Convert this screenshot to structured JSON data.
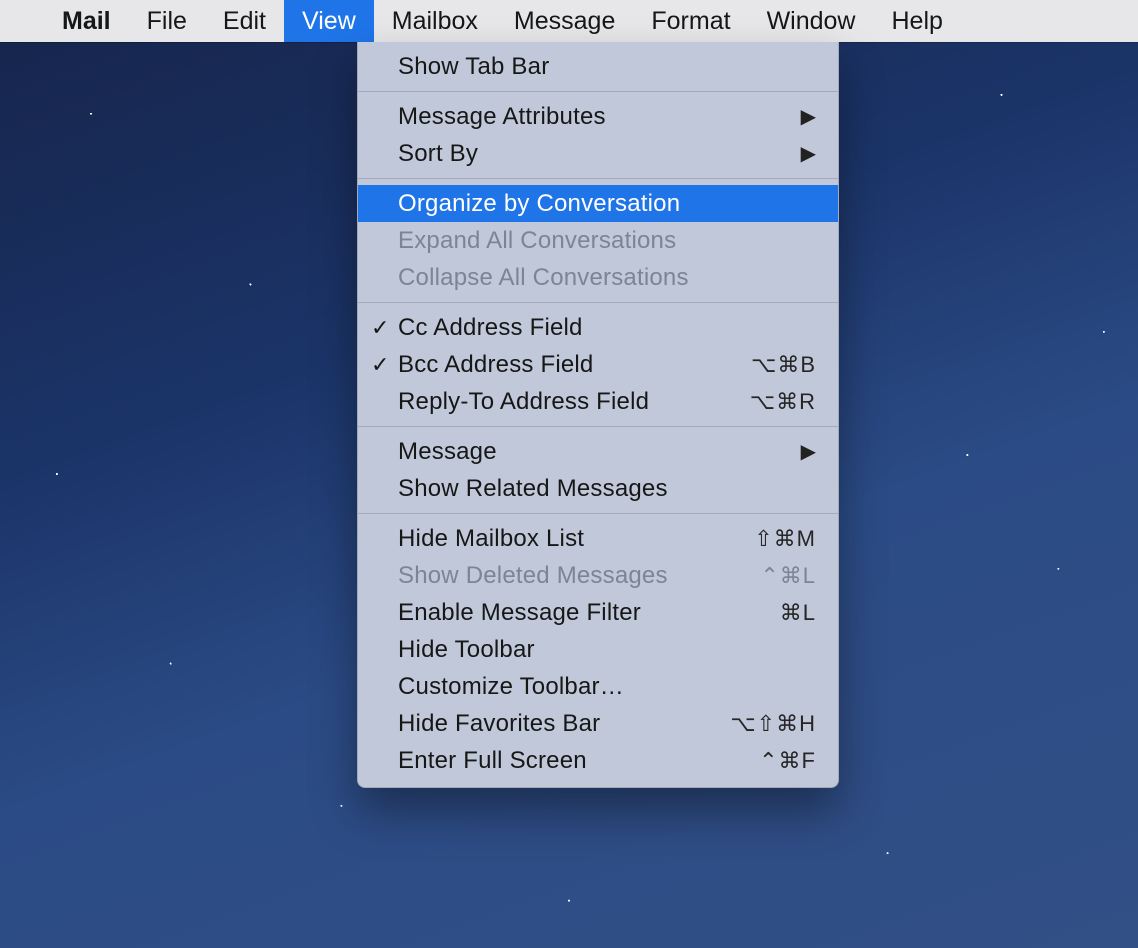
{
  "menubar": {
    "apple_icon": "",
    "items": [
      {
        "label": "Mail",
        "bold": true
      },
      {
        "label": "File"
      },
      {
        "label": "Edit"
      },
      {
        "label": "View",
        "open": true
      },
      {
        "label": "Mailbox"
      },
      {
        "label": "Message"
      },
      {
        "label": "Format"
      },
      {
        "label": "Window"
      },
      {
        "label": "Help"
      }
    ]
  },
  "view_menu": {
    "groups": [
      [
        {
          "label": "Show Tab Bar"
        }
      ],
      [
        {
          "label": "Message Attributes",
          "submenu": true
        },
        {
          "label": "Sort By",
          "submenu": true
        }
      ],
      [
        {
          "label": "Organize by Conversation",
          "highlight": true
        },
        {
          "label": "Expand All Conversations",
          "disabled": true
        },
        {
          "label": "Collapse All Conversations",
          "disabled": true
        }
      ],
      [
        {
          "label": "Cc Address Field",
          "checked": true
        },
        {
          "label": "Bcc Address Field",
          "checked": true,
          "shortcut": "⌥⌘B"
        },
        {
          "label": "Reply-To Address Field",
          "shortcut": "⌥⌘R"
        }
      ],
      [
        {
          "label": "Message",
          "submenu": true
        },
        {
          "label": "Show Related Messages"
        }
      ],
      [
        {
          "label": "Hide Mailbox List",
          "shortcut": "⇧⌘M"
        },
        {
          "label": "Show Deleted Messages",
          "shortcut": "⌃⌘L",
          "disabled": true
        },
        {
          "label": "Enable Message Filter",
          "shortcut": "⌘L"
        },
        {
          "label": "Hide Toolbar"
        },
        {
          "label": "Customize Toolbar…"
        },
        {
          "label": "Hide Favorites Bar",
          "shortcut": "⌥⇧⌘H"
        },
        {
          "label": "Enter Full Screen",
          "shortcut": "⌃⌘F"
        }
      ]
    ]
  }
}
